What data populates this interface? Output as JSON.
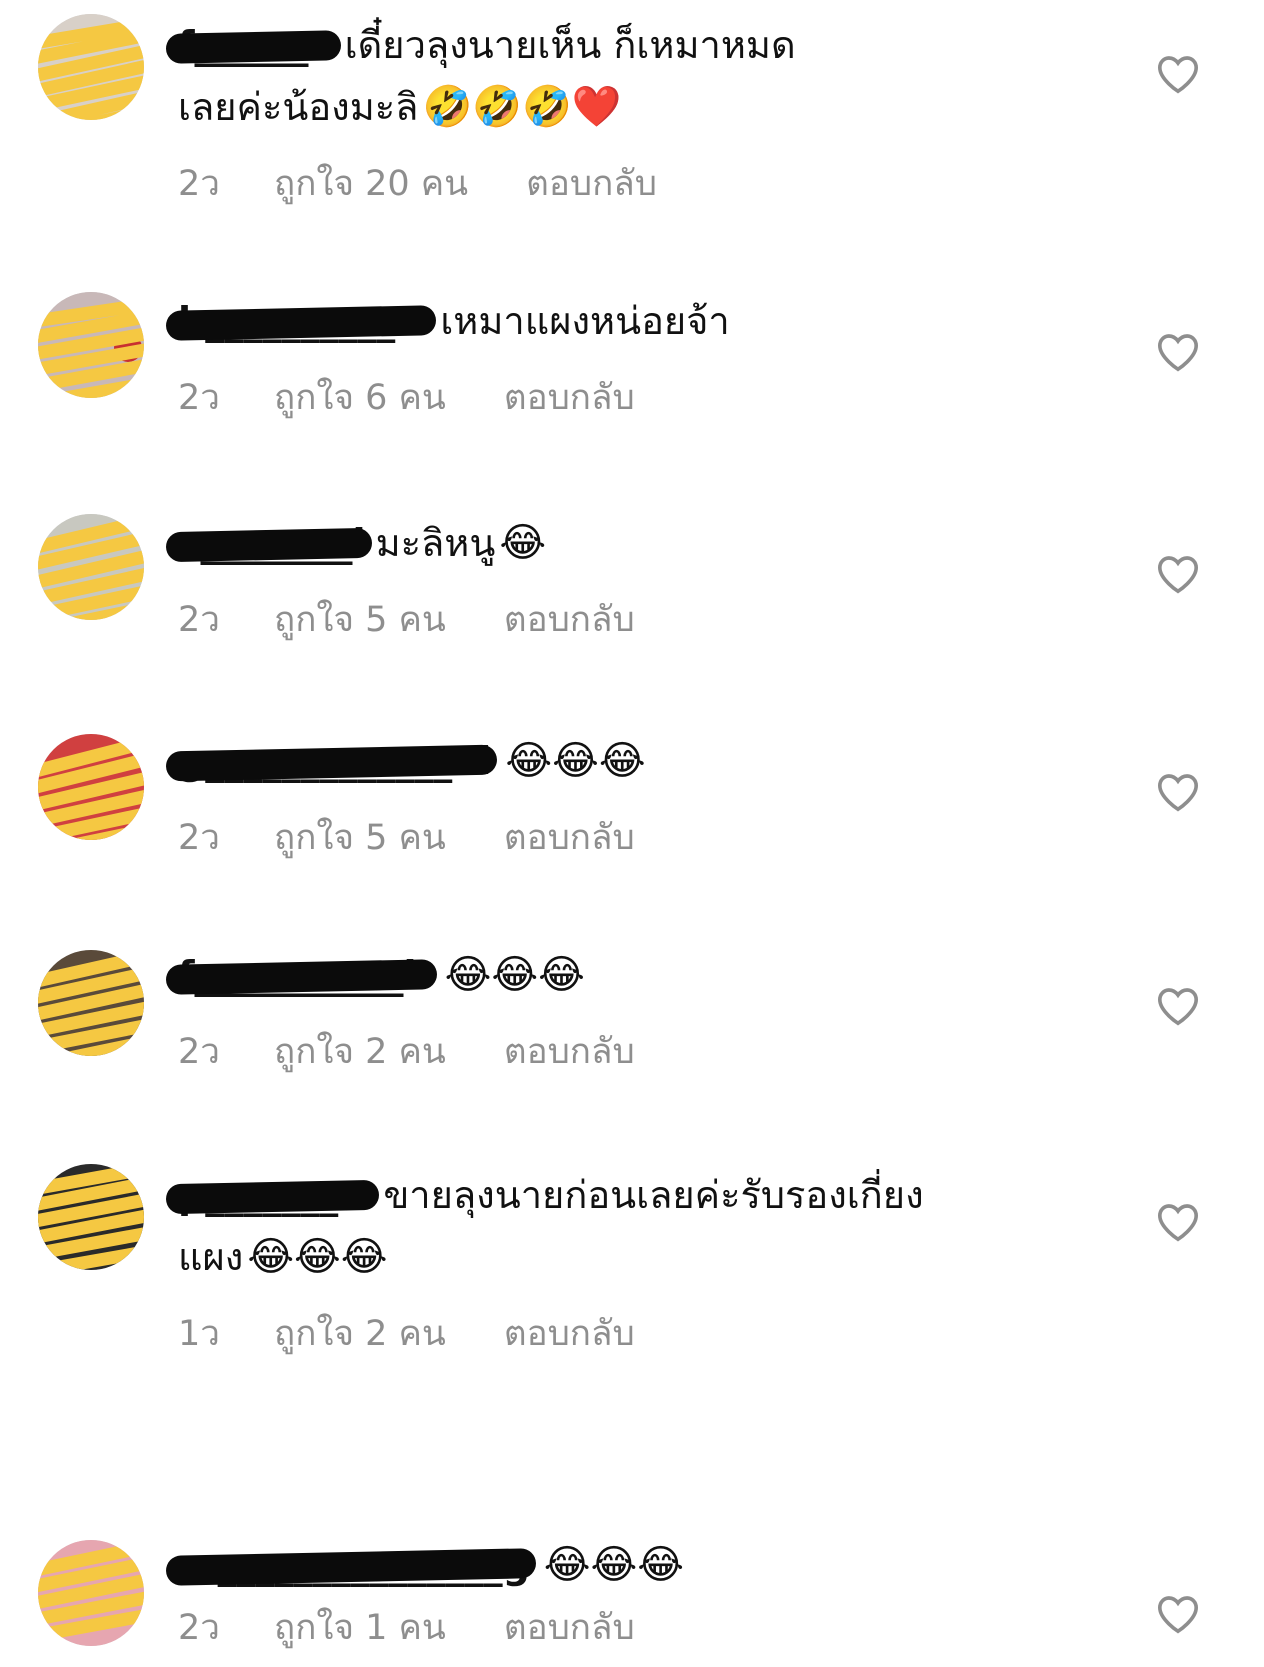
{
  "comments": [
    {
      "username": "f______o",
      "text": "เดี๋ยวลุงนายเห็น ก็เหมาหมด",
      "text_line2": "เลยค่ะน้องมะลิ",
      "emojis": "🤣🤣🤣❤️",
      "age": "2ว",
      "likes": "ถูกใจ 20 คน",
      "reply": "ตอบกลับ",
      "avatar_color": "#d8d0c8"
    },
    {
      "username": "b__________w",
      "text": "เหมาแผงหน่อยจ้า",
      "emojis": "",
      "age": "2ว",
      "likes": "ถูกใจ 6 คน",
      "reply": "ตอบกลับ",
      "avatar_color": "#c8b8b8"
    },
    {
      "username": "c________l",
      "text": "มะลิหนู",
      "emojis": "😂",
      "age": "2ว",
      "likes": "ถูกใจ 5 คน",
      "reply": "ตอบกลับ",
      "avatar_color": "#c8c8c0"
    },
    {
      "username": "g_____________oi",
      "text": "",
      "emojis": "😂😂😂",
      "age": "2ว",
      "likes": "ถูกใจ 5 คน",
      "reply": "ตอบกลับ",
      "avatar_color": "#d04040"
    },
    {
      "username": "f___________h",
      "text": "",
      "emojis": "😂😂😂",
      "age": "2ว",
      "likes": "ถูกใจ 2 คน",
      "reply": "ตอบกลับ",
      "avatar_color": "#5a4a3a"
    },
    {
      "username": "p_______w",
      "text": "ขายลุงนายก่อนเลยค่ะรับรองเกี่ยง",
      "text_line2": "แผง",
      "emojis": "😂😂😂",
      "age": "1ว",
      "likes": "ถูกใจ 2 คน",
      "reply": "ตอบกลับ",
      "avatar_color": "#2a2a2a"
    },
    {
      "username": "m_______________g",
      "text": "",
      "emojis": "😂😂😂",
      "age": "2ว",
      "likes": "ถูกใจ 1 คน",
      "reply": "ตอบกลับ",
      "avatar_color": "#e6a6b0"
    }
  ],
  "colors": {
    "meta": "#8e8e8e",
    "text": "#111111",
    "redaction": "#0b0b0b",
    "avatar_scribble": "#f5c842"
  },
  "icons": {
    "like": "heart-outline-icon"
  }
}
